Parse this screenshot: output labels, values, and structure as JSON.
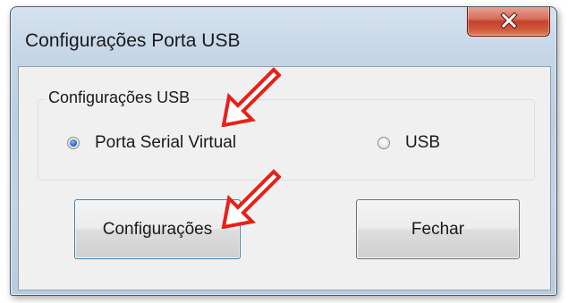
{
  "window": {
    "title": "Configurações Porta USB",
    "close_icon": "close-x-icon"
  },
  "group": {
    "label": "Configurações USB",
    "options": [
      {
        "label": "Porta Serial Virtual",
        "checked": true
      },
      {
        "label": "USB",
        "checked": false
      }
    ]
  },
  "buttons": {
    "config_label": "Configurações",
    "close_label": "Fechar"
  },
  "annotations": {
    "arrow_color": "#e8201a",
    "arrow_icon": "red-outline-arrow"
  }
}
